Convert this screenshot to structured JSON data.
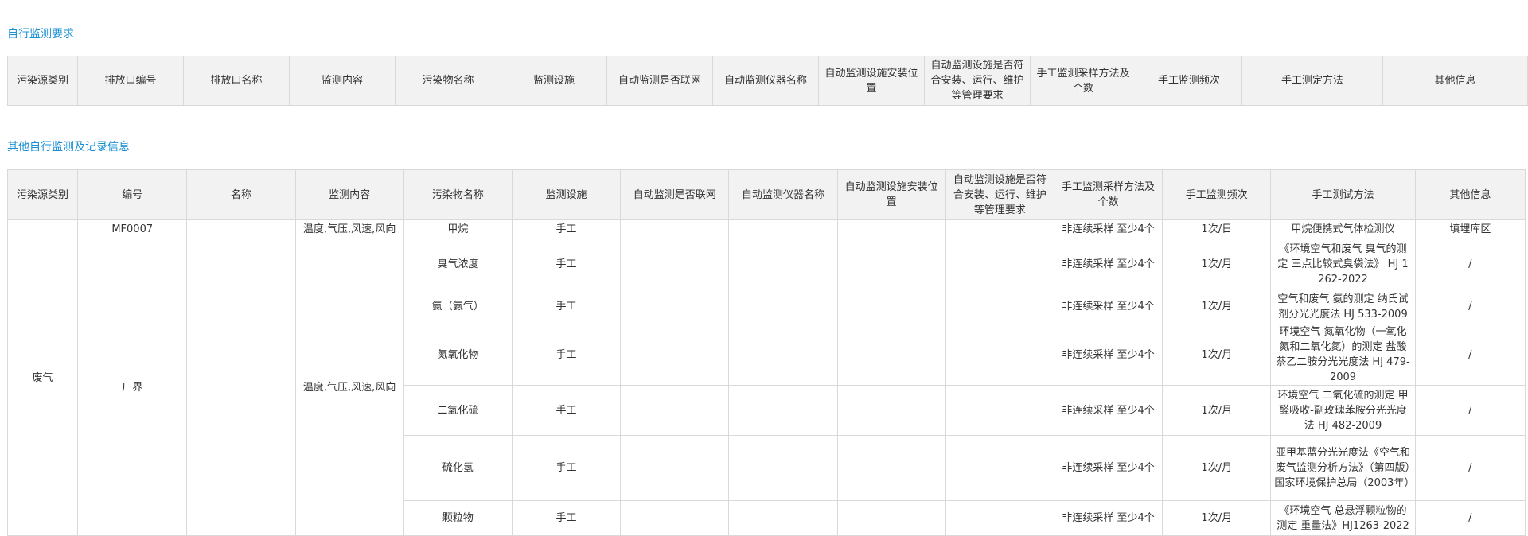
{
  "section1": {
    "title": "自行监测要求",
    "headers": [
      "污染源类别",
      "排放口编号",
      "排放口名称",
      "监测内容",
      "污染物名称",
      "监测设施",
      "自动监测是否联网",
      "自动监测仪器名称",
      "自动监测设施安装位置",
      "自动监测设施是否符合安装、运行、维护等管理要求",
      "手工监测采样方法及个数",
      "手工监测频次",
      "手工测定方法",
      "其他信息"
    ]
  },
  "section2": {
    "title": "其他自行监测及记录信息",
    "headers": [
      "污染源类别",
      "编号",
      "名称",
      "监测内容",
      "污染物名称",
      "监测设施",
      "自动监测是否联网",
      "自动监测仪器名称",
      "自动监测设施安装位置",
      "自动监测设施是否符合安装、运行、维护等管理要求",
      "手工监测采样方法及个数",
      "手工监测频次",
      "手工测试方法",
      "其他信息"
    ],
    "source_category": "废气",
    "row1": {
      "id": "MF0007",
      "name": "",
      "content": "温度,气压,风速,风向",
      "pollutant": "甲烷",
      "facility": "手工",
      "networked": "",
      "instrument": "",
      "location": "",
      "compliance": "",
      "sampling": "非连续采样 至少4个",
      "frequency": "1次/日",
      "method": "甲烷便携式气体检测仪",
      "other": "填埋库区"
    },
    "group": {
      "id": "厂界",
      "name": "",
      "content": "温度,气压,风速,风向",
      "rows": [
        {
          "pollutant": "臭气浓度",
          "facility": "手工",
          "sampling": "非连续采样 至少4个",
          "frequency": "1次/月",
          "method": "《环境空气和废气 臭气的测定 三点比较式臭袋法》 HJ 1262-2022",
          "other": "/"
        },
        {
          "pollutant": "氨（氨气）",
          "facility": "手工",
          "sampling": "非连续采样 至少4个",
          "frequency": "1次/月",
          "method": "空气和废气 氨的测定 纳氏试剂分光光度法 HJ 533-2009",
          "other": "/"
        },
        {
          "pollutant": "氮氧化物",
          "facility": "手工",
          "sampling": "非连续采样 至少4个",
          "frequency": "1次/月",
          "method": "环境空气 氮氧化物（一氧化氮和二氧化氮）的测定 盐酸萘乙二胺分光光度法 HJ 479-2009",
          "other": "/"
        },
        {
          "pollutant": "二氧化硫",
          "facility": "手工",
          "sampling": "非连续采样 至少4个",
          "frequency": "1次/月",
          "method": "环境空气 二氧化硫的测定 甲醛吸收-副玫瑰苯胺分光光度法 HJ 482-2009",
          "other": "/"
        },
        {
          "pollutant": "硫化氢",
          "facility": "手工",
          "sampling": "非连续采样 至少4个",
          "frequency": "1次/月",
          "method": "亚甲基蓝分光光度法《空气和废气监测分析方法》（第四版）国家环境保护总局（2003年）",
          "other": "/"
        },
        {
          "pollutant": "颗粒物",
          "facility": "手工",
          "sampling": "非连续采样 至少4个",
          "frequency": "1次/月",
          "method": "《环境空气 总悬浮颗粒物的测定 重量法》HJ1263-2022",
          "other": "/"
        }
      ]
    }
  }
}
